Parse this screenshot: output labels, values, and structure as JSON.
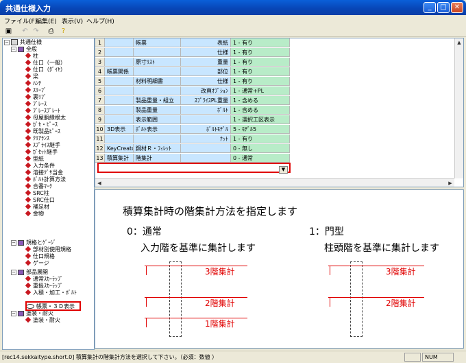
{
  "window": {
    "title": "共通仕様入力"
  },
  "menu": [
    "ファイル(F)",
    "編集(E)",
    "表示(V)",
    "ヘルプ(H)"
  ],
  "toolbar_icons": [
    "save-icon",
    "undo-icon",
    "redo-icon",
    "print-icon",
    "help-icon"
  ],
  "tree": {
    "root": "共通仕様",
    "groups": [
      {
        "label": "全般",
        "items": [
          "柱",
          "仕口（一般）",
          "仕口（ﾀﾞｲﾔ）",
          "梁",
          "ﾊﾝﾁ",
          "ｽﾘｰﾌﾞ",
          "裏ﾘﾌﾞ",
          "ﾌﾞﾚｰｽ",
          "ﾌﾞﾚｰｽﾌﾟﾚｰﾄ",
          "母屋胴縁根太",
          "ｶﾞｾ・ﾋﾟｰｽ",
          "既製品ﾋﾟｰｽ",
          "ｸﾘｱﾗﾝｽ",
          "ｽﾌﾟﾗｲｽ継手",
          "ｶﾞｾｯﾄ継手",
          "型紙",
          "入力条件",
          "溶接ｸﾞｻ当金",
          "ﾎﾞﾙﾄ計算方法",
          "合番ﾏｰｸ",
          "SRC柱",
          "SRC仕口",
          "補足材",
          "金物"
        ]
      },
      {
        "label": "規格とｹﾞｰｼﾞ",
        "items": [
          "部材別使用規格",
          "仕口規格",
          "ゲージ"
        ]
      },
      {
        "label": "部品展開",
        "items": [
          "通常ｽｶｰﾗｯﾌﾟ",
          "重扱ｽｶｰﾗｯﾌﾟ",
          "入積・加工・ﾎﾞﾙﾄ",
          "帳票・３Ｄ表示"
        ]
      },
      {
        "label": "塗装・耐火",
        "items": [
          "塗装・耐火"
        ]
      }
    ]
  },
  "grid": {
    "rows": [
      {
        "n": "1",
        "c1": "",
        "c2": "帳票",
        "c3": "表紙",
        "v": "1 - 有り"
      },
      {
        "n": "2",
        "c1": "",
        "c2": "",
        "c3": "仕様",
        "v": "1 - 有り"
      },
      {
        "n": "3",
        "c1": "",
        "c2": "原寸ﾘｽﾄ",
        "c3": "重量",
        "v": "1 - 有り"
      },
      {
        "n": "4",
        "c1": "帳票関係",
        "c2": "",
        "c3": "部位",
        "v": "1 - 有り"
      },
      {
        "n": "5",
        "c1": "",
        "c2": "材料明細書",
        "c3": "仕様",
        "v": "1 - 有り"
      },
      {
        "n": "6",
        "c1": "",
        "c2": "",
        "c3": "改頁ｵﾌﾟｼｮﾝ",
        "v": "1 - 通常+PL"
      },
      {
        "n": "7",
        "c1": "",
        "c2": "製品重量・組立",
        "c3": "ｽﾌﾟﾗｲｽPL重量",
        "v": "1 - 含める"
      },
      {
        "n": "8",
        "c1": "",
        "c2": "製品重量",
        "c3": "ﾎﾞﾙﾄ",
        "v": "1 - 含める"
      },
      {
        "n": "9",
        "c1": "",
        "c2": "表示範囲",
        "c3": "",
        "v": "1 - 選択工区表示"
      },
      {
        "n": "10",
        "c1": "3D表示",
        "c2": "ﾎﾞﾙﾄ表示",
        "c3": "ﾎﾞﾙﾄﾓﾃﾞﾙ",
        "v": "5 - ﾓﾃﾞﾙ5"
      },
      {
        "n": "11",
        "c1": "",
        "c2": "",
        "c3": "ﾅｯﾄ",
        "v": "1 - 有り"
      },
      {
        "n": "12",
        "c1": "KeyCreator連動",
        "c2": "鋼材Ｒ・ﾌｨﾚｯﾄ",
        "c3": "",
        "v": "0 - 無し"
      },
      {
        "n": "13",
        "c1": "積算集計",
        "c2": "階集計",
        "c3": "",
        "v": "0 - 通常"
      }
    ]
  },
  "description": {
    "heading": "積算集計時の階集計方法を指定します",
    "opt0_title": "0：通常",
    "opt0_sub": "入力階を基準に集計します",
    "opt1_title": "1：門型",
    "opt1_sub": "柱頭階を基準に集計します",
    "left_labels": [
      "3階集計",
      "2階集計",
      "1階集計"
    ],
    "right_labels": [
      "3階集計",
      "2階集計"
    ]
  },
  "status": {
    "message": "[rec14.sekkaitype.short.0] 積算集計の階集計方法を選択して下さい。（必須：数値 ）",
    "num": "NUM"
  }
}
